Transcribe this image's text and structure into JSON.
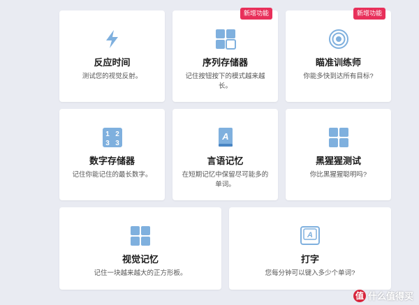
{
  "cards": [
    {
      "title": "反应时间",
      "desc": "测试您的视觉反射。",
      "icon": "lightning-icon"
    },
    {
      "title": "序列存储器",
      "desc": "记住按钮按下的模式越来越长。",
      "badge": "新增功能",
      "icon": "grid-icon"
    },
    {
      "title": "瞄准训练师",
      "desc": "你能多快到达所有目标?",
      "badge": "新增功能",
      "icon": "target-icon"
    },
    {
      "title": "数字存储器",
      "desc": "记住你能记住的最长数字。",
      "icon": "number-grid-icon"
    },
    {
      "title": "言语记忆",
      "desc": "在短期记忆中保留尽可能多的单词。",
      "icon": "book-icon"
    },
    {
      "title": "黑猩猩测试",
      "desc": "你比黑猩猩聪明吗?",
      "icon": "grid-icon"
    },
    {
      "title": "视觉记忆",
      "desc": "记住一块越来越大的正方形板。",
      "icon": "grid-icon"
    },
    {
      "title": "打字",
      "desc": "您每分钟可以键入多少个单词?",
      "icon": "keyboard-key-icon"
    }
  ],
  "watermark": {
    "circle": "值",
    "text": "什么值得买"
  },
  "colors": {
    "icon": "#7fb0de",
    "iconDark": "#4a86c4",
    "badge": "#e8305a",
    "background": "#e9ebf2"
  }
}
